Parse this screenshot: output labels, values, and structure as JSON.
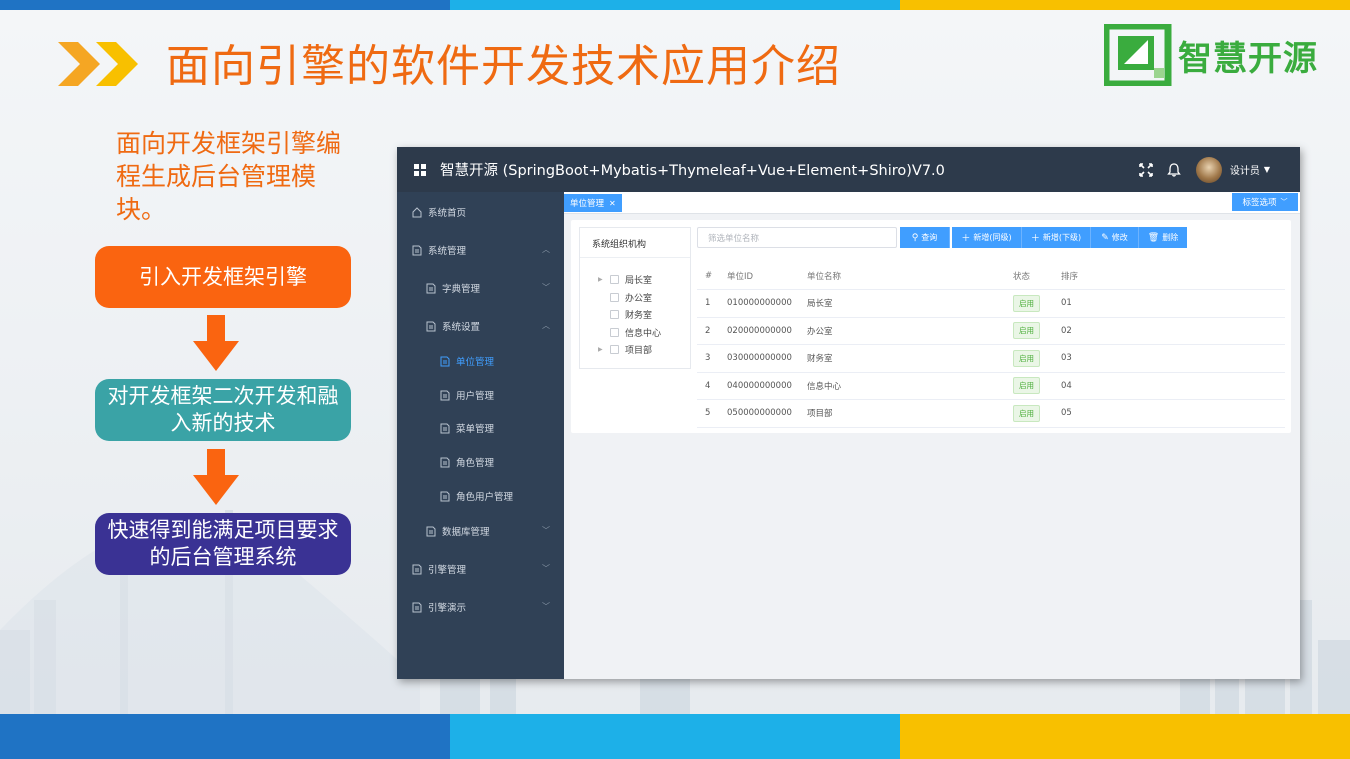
{
  "colors": {
    "accent_orange": "#ef6a12",
    "step1": "#fa6410",
    "step2": "#3aa3a6",
    "step3": "#3a3294",
    "brand_green": "#3aac3e",
    "primary_blue": "#409eff",
    "sidebar_bg": "#304156"
  },
  "slide": {
    "title": "面向引擎的软件开发技术应用介绍",
    "logo_text": "智慧开源",
    "intro": "面向开发框架引擎编程生成后台管理模块。",
    "steps": [
      "引入开发框架引擎",
      "对开发框架二次开发和融入新的技术",
      "快速得到能满足项目要求的后台管理系统"
    ]
  },
  "app": {
    "title": "智慧开源 (SpringBoot+Mybatis+Thymeleaf+Vue+Element+Shiro)V7.0",
    "user_name": "设计员",
    "header_icons": [
      "fullscreen-icon",
      "bell-icon"
    ],
    "sidebar": {
      "items": [
        {
          "label": "系统首页",
          "icon": "home-icon"
        },
        {
          "label": "系统管理",
          "icon": "doc-icon"
        },
        {
          "label": "字典管理",
          "icon": "doc-icon"
        },
        {
          "label": "系统设置",
          "icon": "doc-icon"
        },
        {
          "label": "单位管理",
          "icon": "doc-icon",
          "active": true
        },
        {
          "label": "用户管理",
          "icon": "doc-icon"
        },
        {
          "label": "菜单管理",
          "icon": "doc-icon"
        },
        {
          "label": "角色管理",
          "icon": "doc-icon"
        },
        {
          "label": "角色用户管理",
          "icon": "doc-icon"
        },
        {
          "label": "数据库管理",
          "icon": "doc-icon"
        },
        {
          "label": "引擎管理",
          "icon": "doc-icon"
        },
        {
          "label": "引擎演示",
          "icon": "doc-icon"
        }
      ]
    },
    "tabs": {
      "active_tab": "单位管理",
      "options_label": "标签选项"
    },
    "org_panel": {
      "title": "系统组织机构",
      "tree": [
        "局长室",
        "办公室",
        "财务室",
        "信息中心",
        "项目部"
      ]
    },
    "search": {
      "placeholder": "筛选单位名称"
    },
    "toolbar": {
      "query": "查询",
      "add_same": "新增(同级)",
      "add_child": "新增(下级)",
      "edit": "修改",
      "delete": "删除"
    },
    "table": {
      "headers": [
        "#",
        "单位ID",
        "单位名称",
        "状态",
        "排序"
      ],
      "rows": [
        [
          "1",
          "010000000000",
          "局长室",
          "启用",
          "01"
        ],
        [
          "2",
          "020000000000",
          "办公室",
          "启用",
          "02"
        ],
        [
          "3",
          "030000000000",
          "财务室",
          "启用",
          "03"
        ],
        [
          "4",
          "040000000000",
          "信息中心",
          "启用",
          "04"
        ],
        [
          "5",
          "050000000000",
          "项目部",
          "启用",
          "05"
        ]
      ]
    }
  }
}
